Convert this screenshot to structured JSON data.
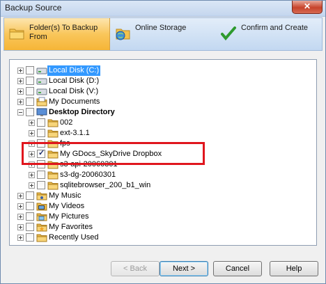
{
  "window": {
    "title": "Backup Source",
    "close_glyph": "✕"
  },
  "steps": [
    {
      "label": "Folder(s) To Backup From",
      "icon": "folder-icon",
      "active": true
    },
    {
      "label": "Online Storage",
      "icon": "globe-folder-icon",
      "active": false
    },
    {
      "label": "Confirm and Create",
      "icon": "checkmark-icon",
      "active": false
    }
  ],
  "tree": [
    {
      "label": "Local Disk (C:)",
      "checked": false,
      "icon": "drive-icon",
      "selected": true
    },
    {
      "label": "Local Disk (D:)",
      "checked": false,
      "icon": "drive-icon"
    },
    {
      "label": "Local Disk (V:)",
      "checked": false,
      "icon": "drive-icon"
    },
    {
      "label": "My Documents",
      "checked": false,
      "icon": "documents-folder-icon"
    },
    {
      "label": "Desktop Directory",
      "checked": false,
      "icon": "desktop-icon",
      "bold": true
    },
    {
      "label": "002",
      "checked": false,
      "icon": "folder-icon"
    },
    {
      "label": "ext-3.1.1",
      "checked": false,
      "icon": "folder-icon"
    },
    {
      "label": "fps",
      "checked": false,
      "icon": "folder-icon"
    },
    {
      "label": "My GDocs_SkyDrive Dropbox",
      "checked": true,
      "icon": "folder-icon"
    },
    {
      "label": "s3-api-20060301",
      "checked": false,
      "icon": "folder-icon"
    },
    {
      "label": "s3-dg-20060301",
      "checked": false,
      "icon": "folder-icon"
    },
    {
      "label": "sqlitebrowser_200_b1_win",
      "checked": false,
      "icon": "folder-icon"
    },
    {
      "label": "My Music",
      "checked": false,
      "icon": "music-folder-icon"
    },
    {
      "label": "My Videos",
      "checked": false,
      "icon": "videos-folder-icon"
    },
    {
      "label": "My Pictures",
      "checked": false,
      "icon": "pictures-folder-icon"
    },
    {
      "label": "My Favorites",
      "checked": false,
      "icon": "favorites-folder-icon"
    },
    {
      "label": "Recently Used",
      "checked": false,
      "icon": "folder-icon"
    }
  ],
  "buttons": {
    "back": "< Back",
    "next": "Next >",
    "cancel": "Cancel",
    "help": "Help"
  },
  "colors": {
    "highlight": "#e0161d",
    "selection": "#3399ff",
    "active_step": "#f9c65b"
  }
}
